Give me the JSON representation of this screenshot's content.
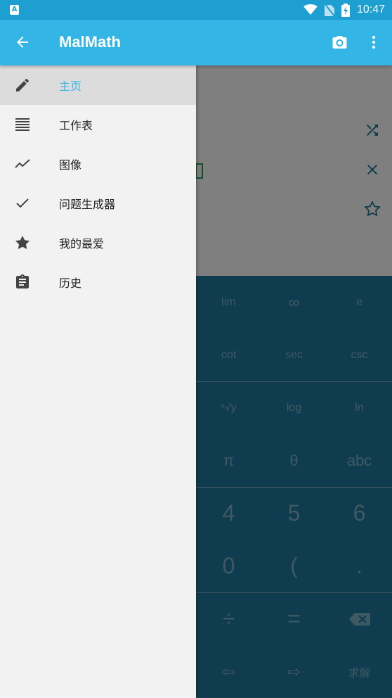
{
  "status_bar": {
    "time": "10:47",
    "notification_letter": "A"
  },
  "app_bar": {
    "title": "MalMath"
  },
  "drawer": {
    "items": [
      {
        "label": "主页",
        "icon": "pencil-icon",
        "active": true
      },
      {
        "label": "工作表",
        "icon": "list-icon"
      },
      {
        "label": "图像",
        "icon": "graph-icon"
      },
      {
        "label": "问题生成器",
        "icon": "check-icon"
      },
      {
        "label": "我的最爱",
        "icon": "star-icon"
      },
      {
        "label": "历史",
        "icon": "clipboard-icon"
      }
    ]
  },
  "keypad": {
    "rows": [
      [
        "lim",
        "∞",
        "e"
      ],
      [
        "cot",
        "sec",
        "csc"
      ],
      [
        "ˣ√y",
        "log",
        "ln"
      ],
      [
        "π",
        "θ",
        "abc"
      ],
      [
        "4",
        "5",
        "6"
      ],
      [
        "0",
        "(",
        "."
      ],
      [
        "÷",
        "=",
        "backspace"
      ],
      [
        "⇦",
        "⇨",
        "求解"
      ]
    ]
  },
  "colors": {
    "status_bar": "#1e9fd2",
    "app_bar": "#33b5e5",
    "keypad": "#1f7a9e",
    "active_label": "#33b5e5"
  }
}
